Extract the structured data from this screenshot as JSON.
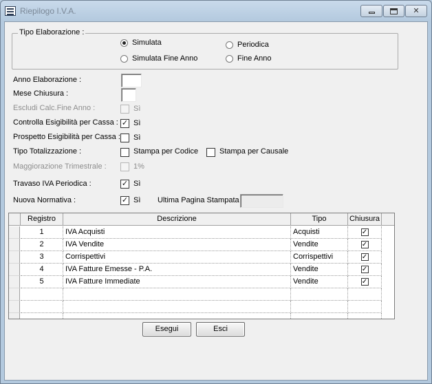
{
  "window": {
    "title": "Riepilogo I.V.A."
  },
  "tipo_elaborazione": {
    "legend": "Tipo Elaborazione :",
    "options": [
      {
        "label": "Simulata",
        "selected": true
      },
      {
        "label": "Periodica",
        "selected": false
      },
      {
        "label": "Simulata Fine Anno",
        "selected": false
      },
      {
        "label": "Fine Anno",
        "selected": false
      }
    ]
  },
  "fields": {
    "anno_label": "Anno Elaborazione :",
    "anno_value": "",
    "mese_label": "Mese Chiusura :",
    "mese_value": "",
    "escludi_label": "Escludi Calc.Fine Anno :",
    "escludi_check": "Sì",
    "controlla_label": "Controlla Esigibilità per Cassa :",
    "controlla_check": "Sì",
    "prospetto_label": "Prospetto Esigibilità per Cassa :",
    "prospetto_check": "Sì",
    "tipo_tot_label": "Tipo Totalizzazione :",
    "stampa_codice": "Stampa per Codice",
    "stampa_causale": "Stampa per Causale",
    "magg_label": "Maggiorazione Trimestrale :",
    "magg_check": "1%",
    "travaso_label": "Travaso IVA Periodica :",
    "travaso_check": "Sì",
    "nuova_label": "Nuova Normativa :",
    "nuova_check": "Sì",
    "ultima_label": "Ultima Pagina Stampata :",
    "ultima_value": ""
  },
  "checks": {
    "escludi": false,
    "controlla": true,
    "prospetto": false,
    "stampa_codice": false,
    "stampa_causale": false,
    "magg": false,
    "travaso": true,
    "nuova": true
  },
  "table": {
    "columns": [
      "Registro",
      "Descrizione",
      "Tipo",
      "Chiusura"
    ],
    "rows": [
      {
        "registro": "1",
        "descrizione": "IVA Acquisti",
        "tipo": "Acquisti",
        "chiusura": true
      },
      {
        "registro": "2",
        "descrizione": "IVA Vendite",
        "tipo": "Vendite",
        "chiusura": true
      },
      {
        "registro": "3",
        "descrizione": "Corrispettivi",
        "tipo": "Corrispettivi",
        "chiusura": true
      },
      {
        "registro": "4",
        "descrizione": "IVA Fatture Emesse - P.A.",
        "tipo": "Vendite",
        "chiusura": true
      },
      {
        "registro": "5",
        "descrizione": "IVA Fatture Immediate",
        "tipo": "Vendite",
        "chiusura": true
      }
    ]
  },
  "buttons": {
    "esegui": "Esegui",
    "esci": "Esci"
  }
}
